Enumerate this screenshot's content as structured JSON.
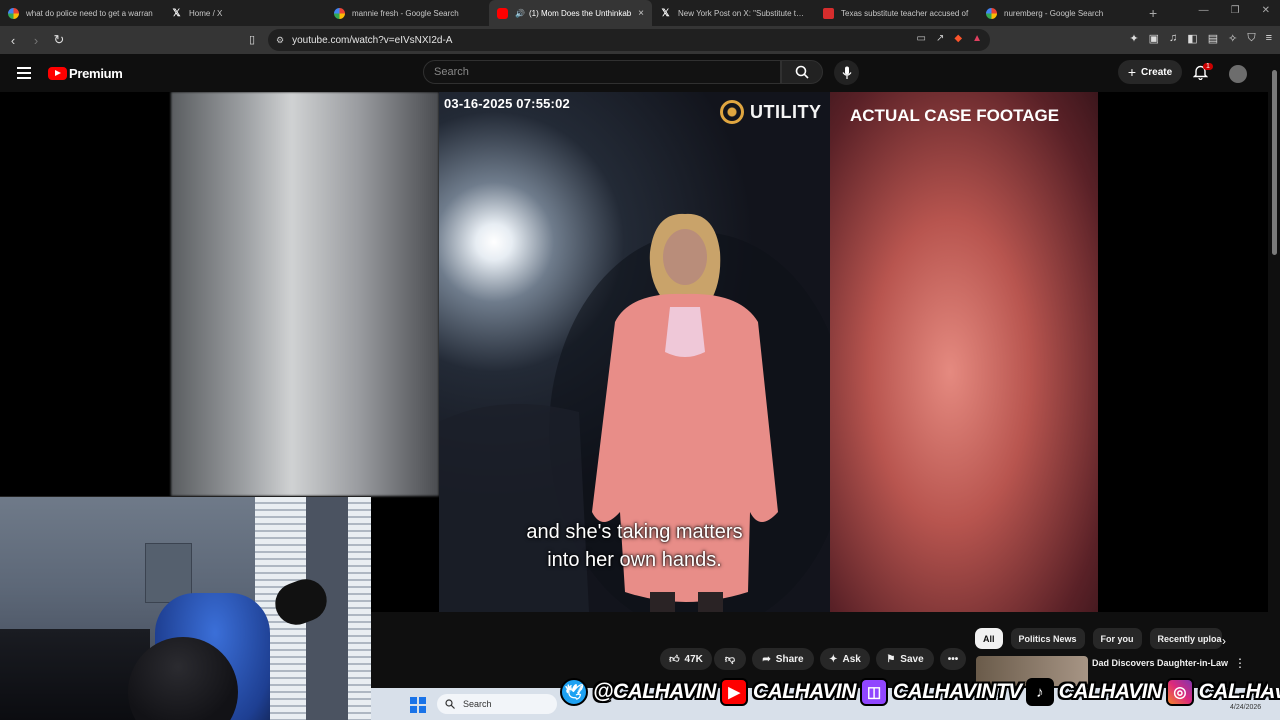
{
  "browser": {
    "tabs": [
      {
        "title": "what do police need to get a warran",
        "favicon": "google-icon"
      },
      {
        "title": "Home / X",
        "favicon": "x-icon"
      },
      {
        "title": "mannie fresh - Google Search",
        "favicon": "google-icon"
      },
      {
        "title": "(1) Mom Does the Unthinkab",
        "favicon": "youtube-icon",
        "active": true
      },
      {
        "title": "New York Post on X: \"Substitute teac",
        "favicon": "x-icon"
      },
      {
        "title": "Texas substitute teacher accused of",
        "favicon": "news-icon"
      },
      {
        "title": "nuremberg - Google Search",
        "favicon": "google-icon"
      }
    ],
    "url": "youtube.com/watch?v=eIVsNXI2d-A"
  },
  "youtube": {
    "logo_label": "Premium",
    "search_placeholder": "Search",
    "create_label": "Create",
    "notification_count": "1"
  },
  "video": {
    "timestamp": "03-16-2025 07:55:02",
    "watermark": "UTILITY",
    "overlay_caption": "ACTUAL CASE FOOTAGE",
    "subtitle_line1": "and she's taking matters",
    "subtitle_line2": "into her own hands."
  },
  "actions": {
    "likes": "47K",
    "share": "Share",
    "ask": "Ask",
    "save": "Save"
  },
  "chips": [
    "All",
    "Politics News",
    "For you",
    "Recently uploa"
  ],
  "recommendation": {
    "title": "Dad Discovers Daughter-in-Law"
  },
  "taskbar": {
    "search_label": "Search",
    "date": "4/24/2026"
  },
  "stream_banner": [
    {
      "icon": "twitter-icon",
      "handle": "@CALHAVIN"
    },
    {
      "icon": "youtube-icon",
      "handle": "CALHAVIN"
    },
    {
      "icon": "twitch-icon",
      "handle": "CALHAVINTV"
    },
    {
      "icon": "tiktok-icon",
      "handle": "CALHAVIN"
    },
    {
      "icon": "instagram-icon",
      "handle": "CAL.HAVIN"
    }
  ],
  "colors": {
    "youtube_red": "#ff0000",
    "accent_gold": "#e0a640",
    "page_bg": "#0f0f0f"
  }
}
